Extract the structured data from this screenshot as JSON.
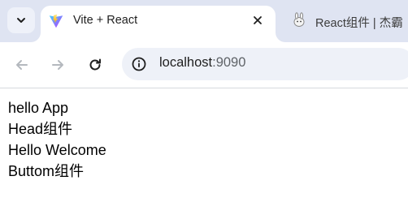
{
  "tabs": {
    "active": {
      "title": "Vite + React",
      "icon": "vite-logo-icon"
    },
    "inactive": {
      "title": "React组件 | 杰霸",
      "icon": "rabbit-favicon-icon"
    }
  },
  "toolbar": {
    "url_host": "localhost",
    "url_port": ":9090"
  },
  "page": {
    "lines": [
      "hello App",
      "Head组件",
      "Hello Welcome",
      "Buttom组件"
    ]
  },
  "colors": {
    "tabstrip": "#dfe4f2",
    "omnibox": "#eef1f8",
    "vite_purple": "#9e5dff",
    "vite_yellow": "#ffc517"
  }
}
